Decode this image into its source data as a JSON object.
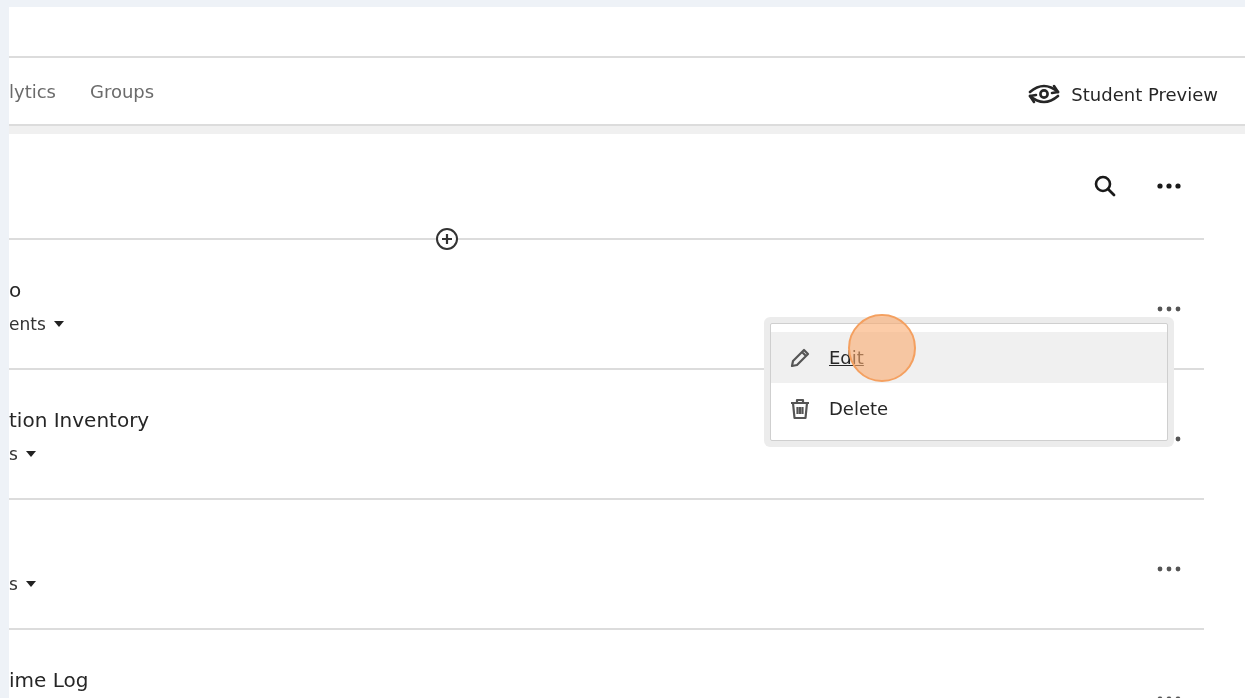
{
  "tabs": [
    {
      "label": "lytics"
    },
    {
      "label": "Groups"
    }
  ],
  "preview_button": {
    "label": "Student Preview"
  },
  "items": [
    {
      "title": "o",
      "subtitle": "ents"
    },
    {
      "title": "tion Inventory",
      "subtitle": "s"
    },
    {
      "subtitle": "s"
    },
    {
      "title": "ime Log"
    }
  ],
  "context_menu": {
    "items": [
      {
        "kind": "edit",
        "label": "Edit",
        "selected": true
      },
      {
        "kind": "delete",
        "label": "Delete",
        "selected": false
      }
    ]
  }
}
